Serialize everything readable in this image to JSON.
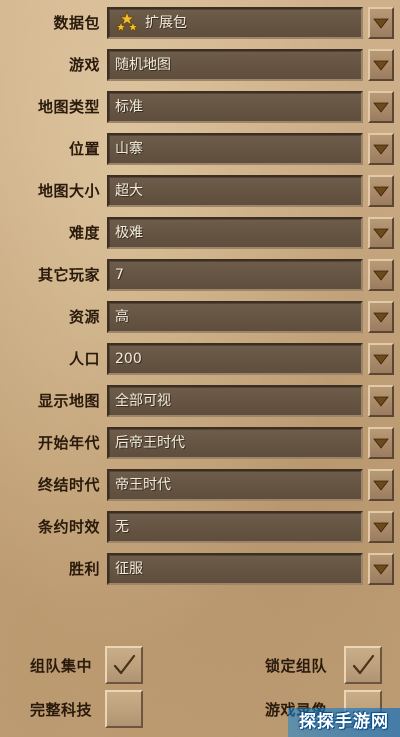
{
  "settings": [
    {
      "label": "数据包",
      "value": "扩展包",
      "icon": "stars-icon"
    },
    {
      "label": "游戏",
      "value": "随机地图"
    },
    {
      "label": "地图类型",
      "value": "标准"
    },
    {
      "label": "位置",
      "value": "山寨"
    },
    {
      "label": "地图大小",
      "value": "超大"
    },
    {
      "label": "难度",
      "value": "极难"
    },
    {
      "label": "其它玩家",
      "value": "7"
    },
    {
      "label": "资源",
      "value": "高"
    },
    {
      "label": "人口",
      "value": "200"
    },
    {
      "label": "显示地图",
      "value": "全部可视"
    },
    {
      "label": "开始年代",
      "value": "后帝王时代"
    },
    {
      "label": "终结时代",
      "value": "帝王时代"
    },
    {
      "label": "条约时效",
      "value": "无"
    },
    {
      "label": "胜利",
      "value": "征服"
    }
  ],
  "options": [
    {
      "label": "组队集中",
      "checked": true
    },
    {
      "label": "锁定组队",
      "checked": true
    },
    {
      "label": "完整科技",
      "checked": false
    },
    {
      "label": "游戏录像",
      "checked": false
    }
  ],
  "watermark": "探探手游网",
  "colors": {
    "background": "#c8a981",
    "field": "#665543",
    "label_text": "#2a1a0c",
    "value_text": "#f3ead9",
    "arrow": "#6b4a1c",
    "check": "#4a3218",
    "watermark_bg": "#1d80c8"
  }
}
